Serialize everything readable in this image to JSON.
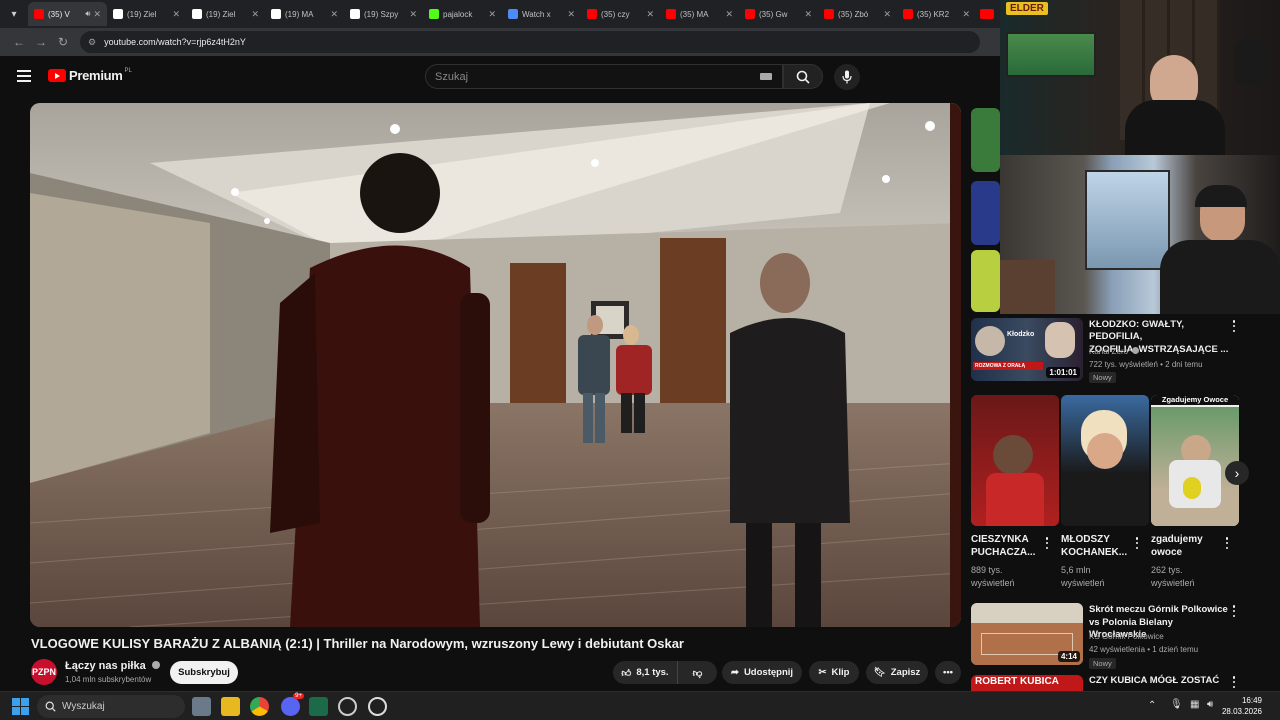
{
  "browser": {
    "tabs": [
      {
        "title": "(35) V",
        "color": "#ff0000",
        "active": true
      },
      {
        "title": "(19) Ziel",
        "color": "#ffffff"
      },
      {
        "title": "(19) Ziel",
        "color": "#ffffff"
      },
      {
        "title": "(19) MA",
        "color": "#ffffff"
      },
      {
        "title": "(19) Szpy",
        "color": "#ffffff"
      },
      {
        "title": "pajalock",
        "color": "#53fc18"
      },
      {
        "title": "Watch x",
        "color": "#4d8bf5"
      },
      {
        "title": "(35) czy",
        "color": "#ff0000"
      },
      {
        "title": "(35) MA",
        "color": "#ff0000"
      },
      {
        "title": "(35) Gw",
        "color": "#ff0000"
      },
      {
        "title": "(35) Zbó",
        "color": "#ff0000"
      },
      {
        "title": "(35) KR2",
        "color": "#ff0000"
      }
    ],
    "url": "youtube.com/watch?v=rjp6z4tH2nY"
  },
  "youtube": {
    "logo_text": "Premium",
    "region": "PL",
    "search_placeholder": "Szukaj"
  },
  "video": {
    "title": "VLOGOWE KULISY BARAŻU Z ALBANIĄ (2:1) | Thriller na Narodowym, wzruszony Lewy i debiutant Oskar",
    "channel": "Łączy nas piłka",
    "subscribers": "1,04 mln subskrybentów",
    "subscribe_label": "Subskrybuj",
    "likes": "8,1 tys.",
    "share_label": "Udostępnij",
    "clip_label": "Klip",
    "save_label": "Zapisz"
  },
  "webcam": {
    "overlay_text": "ELDER"
  },
  "recommendations": [
    {
      "title_line1": "KŁODZKO: GWAŁTY, PEDOFILIA,",
      "title_line2": "ZOOFILIA. WSTRZĄSAJĄCE ...",
      "channel": "Kanał Zero",
      "meta": "722 tys. wyświetleń • 2 dni temu",
      "badge": "Nowy",
      "duration": "1:01:01",
      "thumb_caption": "ROZMOWA Z ORAŁĄ",
      "thumb_label": "Kłodzko"
    },
    {
      "title_line1": "Skrót meczu Górnik Polkowice",
      "title_line2": "vs Polonia Bielany Wrocławskie",
      "channel": "KS Górnik Polkowice",
      "meta": "42 wyświetlenia • 1 dzień temu",
      "badge": "Nowy",
      "duration": "4:14"
    },
    {
      "title_line1": "CZY KUBICA MÓGŁ ZOSTAĆ",
      "thumb_label": "ROBERT KUBICA"
    }
  ],
  "shorts": [
    {
      "title_line1": "CIESZYNKA",
      "title_line2": "PUCHACZA...",
      "views_line1": "889 tys.",
      "views_line2": "wyświetleń"
    },
    {
      "title_line1": "MŁODSZY",
      "title_line2": "KOCHANEK...",
      "views_line1": "5,6 mln",
      "views_line2": "wyświetleń"
    },
    {
      "title_line1": "zgadujemy",
      "title_line2": "owoce",
      "views_line1": "262 tys.",
      "views_line2": "wyświetleń",
      "thumb_label": "Zgadujemy Owoce"
    }
  ],
  "taskbar": {
    "search_placeholder": "Wyszukaj",
    "time": "16:49",
    "date": "28.03.2026",
    "discord_badge": "9+"
  }
}
